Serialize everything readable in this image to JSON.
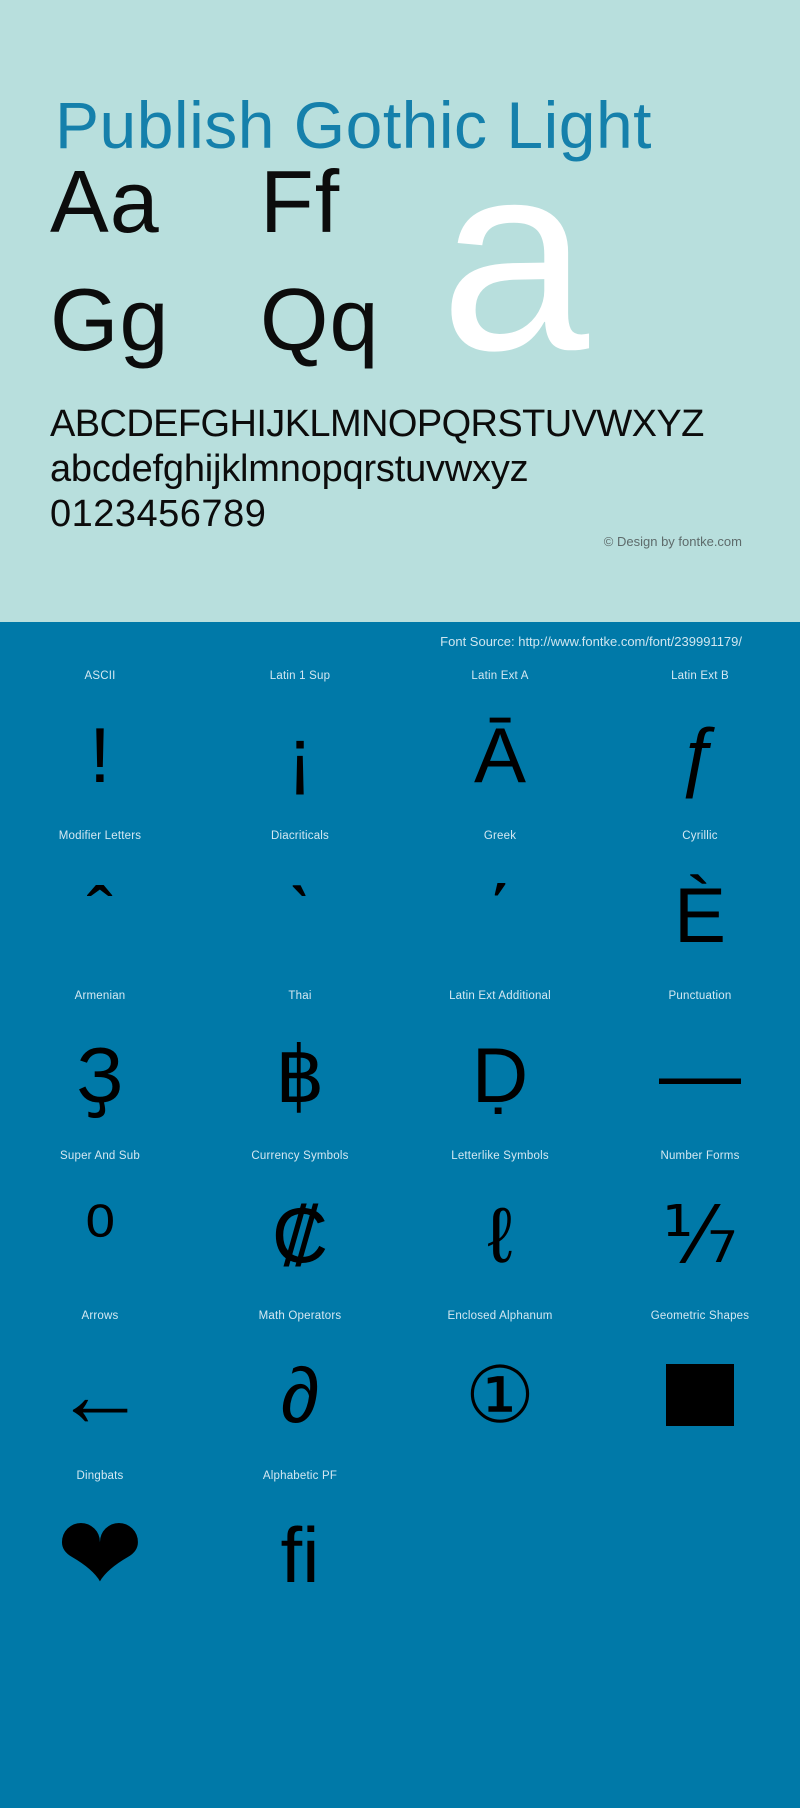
{
  "title": "Publish Gothic Light",
  "colors": {
    "top_background": "#b8dfdd",
    "bottom_background": "#0079a8",
    "title_accent": "#1580ab",
    "glyph_black": "#000000",
    "glyph_white": "#ffffff",
    "label_text": "#d4e8f2",
    "copyright_text": "#5e6b6b"
  },
  "sample_pairs": [
    {
      "text": "Aa"
    },
    {
      "text": "Ff"
    },
    {
      "text": "Gg"
    },
    {
      "text": "Qq"
    }
  ],
  "featured_character": "a",
  "alphabet": {
    "uppercase": "ABCDEFGHIJKLMNOPQRSTUVWXYZ",
    "lowercase": "abcdefghijklmnopqrstuvwxyz",
    "digits": "0123456789"
  },
  "copyright": "© Design by fontke.com",
  "font_source": "Font Source: http://www.fontke.com/font/239991179/",
  "unicode_blocks": [
    {
      "label": "ASCII",
      "glyph": "!",
      "size": "normal"
    },
    {
      "label": "Latin 1 Sup",
      "glyph": "¡",
      "size": "normal"
    },
    {
      "label": "Latin Ext A",
      "glyph": "Ā",
      "size": "normal"
    },
    {
      "label": "Latin Ext B",
      "glyph": "ƒ",
      "size": "normal"
    },
    {
      "label": "Modifier Letters",
      "glyph": "ˆ",
      "size": "normal"
    },
    {
      "label": "Diacriticals",
      "glyph": "ˋ",
      "size": "normal"
    },
    {
      "label": "Greek",
      "glyph": "΄",
      "size": "normal"
    },
    {
      "label": "Cyrillic",
      "glyph": "È",
      "size": "normal"
    },
    {
      "label": "Armenian",
      "glyph": "Ҙ",
      "size": "normal"
    },
    {
      "label": "Thai",
      "glyph": "฿",
      "size": "normal"
    },
    {
      "label": "Latin Ext Additional",
      "glyph": "Ḍ",
      "size": "normal"
    },
    {
      "label": "Punctuation",
      "glyph": "—",
      "size": "dash"
    },
    {
      "label": "Super And Sub",
      "glyph": "⁰",
      "size": "normal"
    },
    {
      "label": "Currency Symbols",
      "glyph": "₡",
      "size": "normal"
    },
    {
      "label": "Letterlike Symbols",
      "glyph": "ℓ",
      "size": "normal"
    },
    {
      "label": "Number Forms",
      "glyph": "⅐",
      "size": "normal"
    },
    {
      "label": "Arrows",
      "glyph": "←",
      "size": "arrow"
    },
    {
      "label": "Math Operators",
      "glyph": "∂",
      "size": "normal"
    },
    {
      "label": "Enclosed Alphanum",
      "glyph": "①",
      "size": "normal"
    },
    {
      "label": "Geometric Shapes",
      "glyph": "■",
      "size": "square"
    },
    {
      "label": "Dingbats",
      "glyph": "❤",
      "size": "heart"
    },
    {
      "label": "Alphabetic PF",
      "glyph": "ﬁ",
      "size": "normal"
    }
  ]
}
